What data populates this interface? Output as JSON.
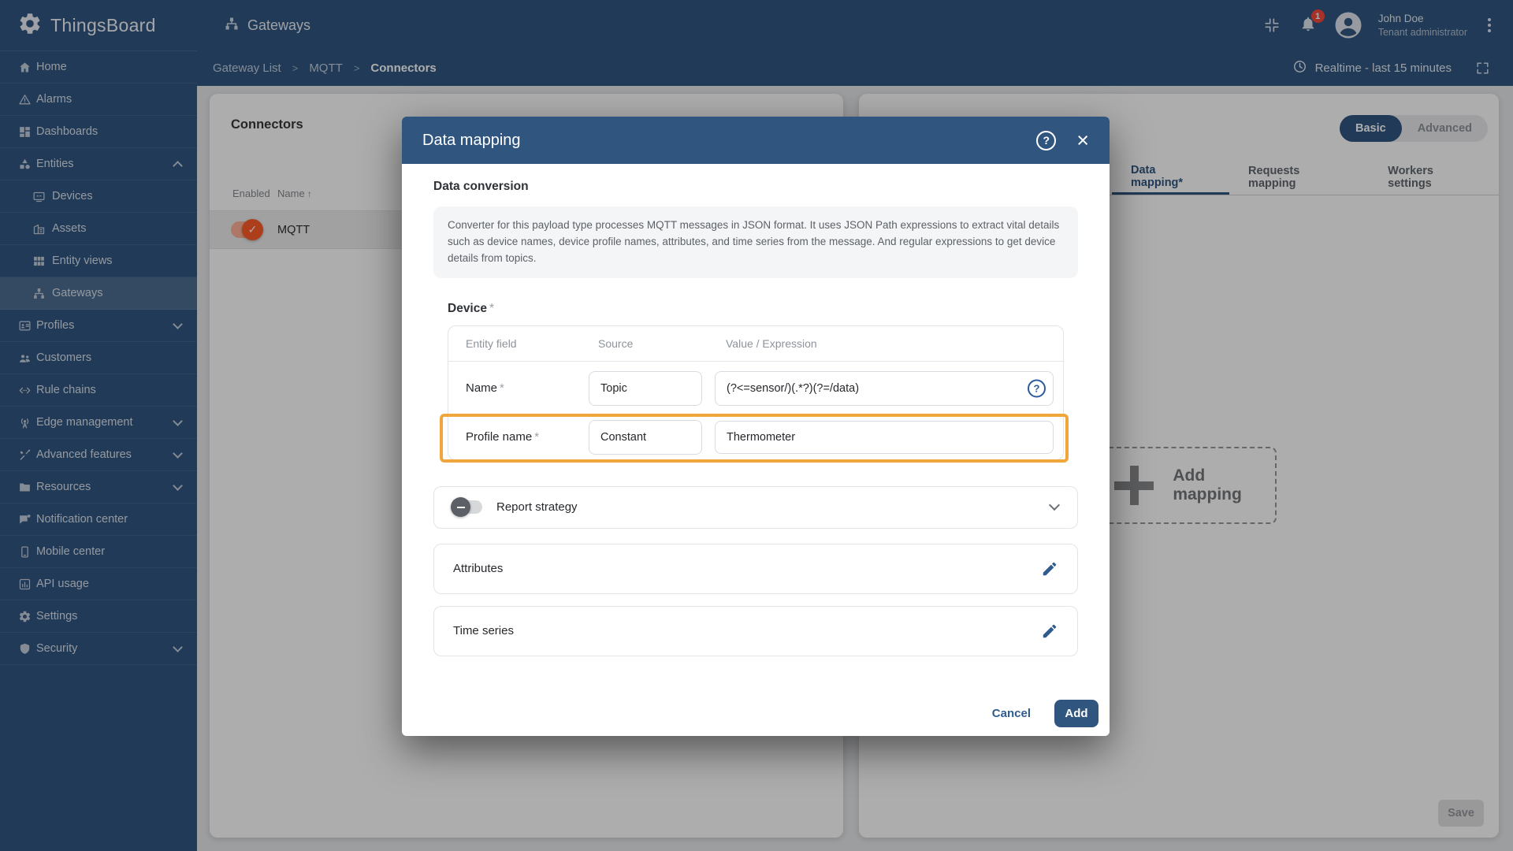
{
  "icons": {
    "help_glyph": "?",
    "close_glyph": "×",
    "check_glyph": "✓",
    "sort_asc_glyph": "↑"
  },
  "topbar": {
    "brand": "ThingsBoard",
    "app_title": "Gateways",
    "notification_count": "1",
    "user_name": "John Doe",
    "user_role": "Tenant administrator",
    "time_window": "Realtime - last 15 minutes"
  },
  "breadcrumb": {
    "separator": ">",
    "items": [
      "Gateway List",
      "MQTT",
      "Connectors"
    ]
  },
  "sidebar": {
    "items": [
      {
        "label": "Home",
        "icon": "home"
      },
      {
        "label": "Alarms",
        "icon": "alarms"
      },
      {
        "label": "Dashboards",
        "icon": "dashboards"
      },
      {
        "label": "Entities",
        "icon": "entities",
        "chevron": "up"
      },
      {
        "label": "Devices",
        "icon": "devices",
        "child": true
      },
      {
        "label": "Assets",
        "icon": "assets",
        "child": true
      },
      {
        "label": "Entity views",
        "icon": "entity-views",
        "child": true
      },
      {
        "label": "Gateways",
        "icon": "gateways",
        "child": true,
        "selected": true
      },
      {
        "label": "Profiles",
        "icon": "profiles",
        "chevron": "down"
      },
      {
        "label": "Customers",
        "icon": "customers"
      },
      {
        "label": "Rule chains",
        "icon": "rule-chains"
      },
      {
        "label": "Edge management",
        "icon": "edge",
        "chevron": "down"
      },
      {
        "label": "Advanced features",
        "icon": "advanced",
        "chevron": "down"
      },
      {
        "label": "Resources",
        "icon": "resources",
        "chevron": "down"
      },
      {
        "label": "Notification center",
        "icon": "notification"
      },
      {
        "label": "Mobile center",
        "icon": "mobile"
      },
      {
        "label": "API usage",
        "icon": "api"
      },
      {
        "label": "Settings",
        "icon": "settings"
      },
      {
        "label": "Security",
        "icon": "security",
        "chevron": "down"
      }
    ]
  },
  "connectors_panel": {
    "title": "Connectors",
    "col_enabled": "Enabled",
    "col_name": "Name",
    "rows": [
      {
        "name": "MQTT",
        "enabled": true
      }
    ]
  },
  "gateway_panel": {
    "modes": [
      "Basic",
      "Advanced"
    ],
    "active_mode": "Basic",
    "tabs": [
      "Data mapping*",
      "Requests mapping",
      "Workers settings"
    ],
    "active_tab": "Data mapping*",
    "add_mapping_label": "Add mapping",
    "save_label": "Save"
  },
  "modal": {
    "title": "Data mapping",
    "required_marker": "*",
    "data_conversion_heading": "Data conversion",
    "data_conversion_description": "Converter for this payload type processes MQTT messages in JSON format. It uses JSON Path expressions to extract vital details such as device names, device profile names, attributes, and time series from the message. And regular expressions to get device details from topics.",
    "device_heading": "Device",
    "table": {
      "col_field": "Entity field",
      "col_source": "Source",
      "col_value": "Value / Expression"
    },
    "rows": [
      {
        "field": "Name",
        "source": "Topic",
        "value": "(?<=sensor/)(.*?)(?=/data)"
      },
      {
        "field": "Profile name",
        "source": "Constant",
        "value": "Thermometer"
      }
    ],
    "report_strategy_label": "Report strategy",
    "report_strategy_enabled": false,
    "attributes_label": "Attributes",
    "time_series_label": "Time series",
    "cancel_label": "Cancel",
    "add_label": "Add"
  },
  "colors": {
    "primary": "#305680",
    "highlight": "#f0a63a",
    "toggle_on": "#ff5c2a",
    "badge_red": "#f5493d",
    "backdrop": "rgba(0,0,0,0.32)"
  }
}
